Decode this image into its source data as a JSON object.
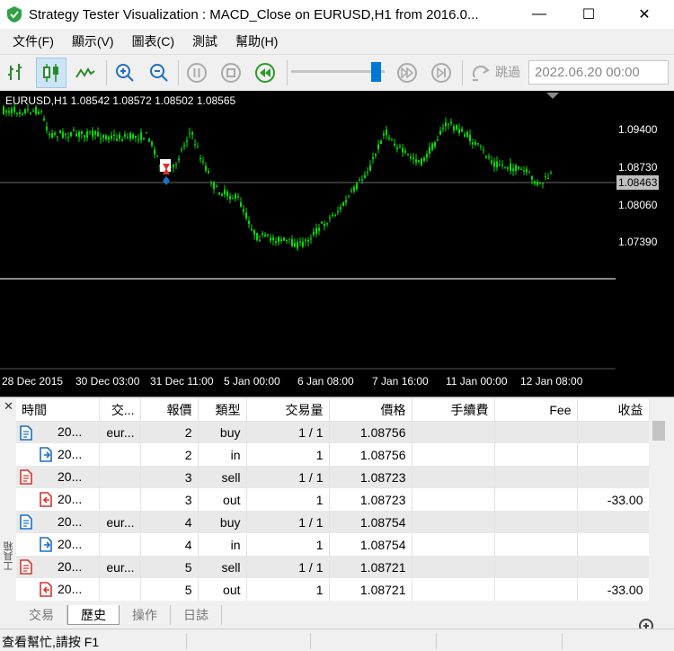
{
  "window": {
    "title": "Strategy Tester Visualization : MACD_Close on EURUSD,H1 from 2016.0...",
    "minimize": "—",
    "maximize": "☐",
    "close": "✕"
  },
  "menu": [
    "文件(F)",
    "顯示(V)",
    "圖表(C)",
    "測試",
    "幫助(H)"
  ],
  "toolbar": {
    "jump_label": "跳過",
    "date_value": "2022.06.20 00:00",
    "speed_fraction": 0.9
  },
  "chart": {
    "symbol_info": "EURUSD,H1  1.08542 1.08572 1.08502 1.08565",
    "price_labels": [
      "1.09400",
      "1.08730",
      "1.08060",
      "1.07390"
    ],
    "current_price": "1.08463",
    "time_labels": [
      "28 Dec 2015",
      "30 Dec 03:00",
      "31 Dec 11:00",
      "5 Jan 00:00",
      "6 Jan 08:00",
      "7 Jan 16:00",
      "11 Jan 00:00",
      "12 Jan 08:00"
    ],
    "colors": {
      "up": "#00e000",
      "down": "#00e000",
      "background": "#000000",
      "grid": "#7f7f7f"
    }
  },
  "toolbox": {
    "side_label": "工具箱",
    "close_glyph": "✕",
    "columns": [
      "時間",
      "交...",
      "報價",
      "類型",
      "交易量",
      "價格",
      "手續費",
      "Fee",
      "收益"
    ],
    "rows": [
      {
        "icon": "order",
        "color": "#1a6fc7",
        "indent": false,
        "time": "20...",
        "symbol": "eur...",
        "ticket": "2",
        "type": "buy",
        "volume": "1 / 1",
        "price": "1.08756",
        "commission": "",
        "fee": "",
        "profit": ""
      },
      {
        "icon": "deal-in",
        "color": "#1a6fc7",
        "indent": true,
        "time": "20...",
        "symbol": "",
        "ticket": "2",
        "type": "in",
        "volume": "1",
        "price": "1.08756",
        "commission": "",
        "fee": "",
        "profit": ""
      },
      {
        "icon": "order",
        "color": "#d9342b",
        "indent": false,
        "time": "20...",
        "symbol": "",
        "ticket": "3",
        "type": "sell",
        "volume": "1 / 1",
        "price": "1.08723",
        "commission": "",
        "fee": "",
        "profit": ""
      },
      {
        "icon": "deal-out",
        "color": "#d9342b",
        "indent": true,
        "time": "20...",
        "symbol": "",
        "ticket": "3",
        "type": "out",
        "volume": "1",
        "price": "1.08723",
        "commission": "",
        "fee": "",
        "profit": "-33.00"
      },
      {
        "icon": "order",
        "color": "#1a6fc7",
        "indent": false,
        "time": "20...",
        "symbol": "eur...",
        "ticket": "4",
        "type": "buy",
        "volume": "1 / 1",
        "price": "1.08754",
        "commission": "",
        "fee": "",
        "profit": ""
      },
      {
        "icon": "deal-in",
        "color": "#1a6fc7",
        "indent": true,
        "time": "20...",
        "symbol": "",
        "ticket": "4",
        "type": "in",
        "volume": "1",
        "price": "1.08754",
        "commission": "",
        "fee": "",
        "profit": ""
      },
      {
        "icon": "order",
        "color": "#d9342b",
        "indent": false,
        "time": "20...",
        "symbol": "eur...",
        "ticket": "5",
        "type": "sell",
        "volume": "1 / 1",
        "price": "1.08721",
        "commission": "",
        "fee": "",
        "profit": ""
      },
      {
        "icon": "deal-out",
        "color": "#d9342b",
        "indent": true,
        "time": "20...",
        "symbol": "",
        "ticket": "5",
        "type": "out",
        "volume": "1",
        "price": "1.08721",
        "commission": "",
        "fee": "",
        "profit": "-33.00"
      }
    ],
    "tabs": [
      "交易",
      "歷史",
      "操作",
      "日誌"
    ],
    "active_tab": 1
  },
  "status": {
    "text": "查看幫忙,請按 F1"
  }
}
